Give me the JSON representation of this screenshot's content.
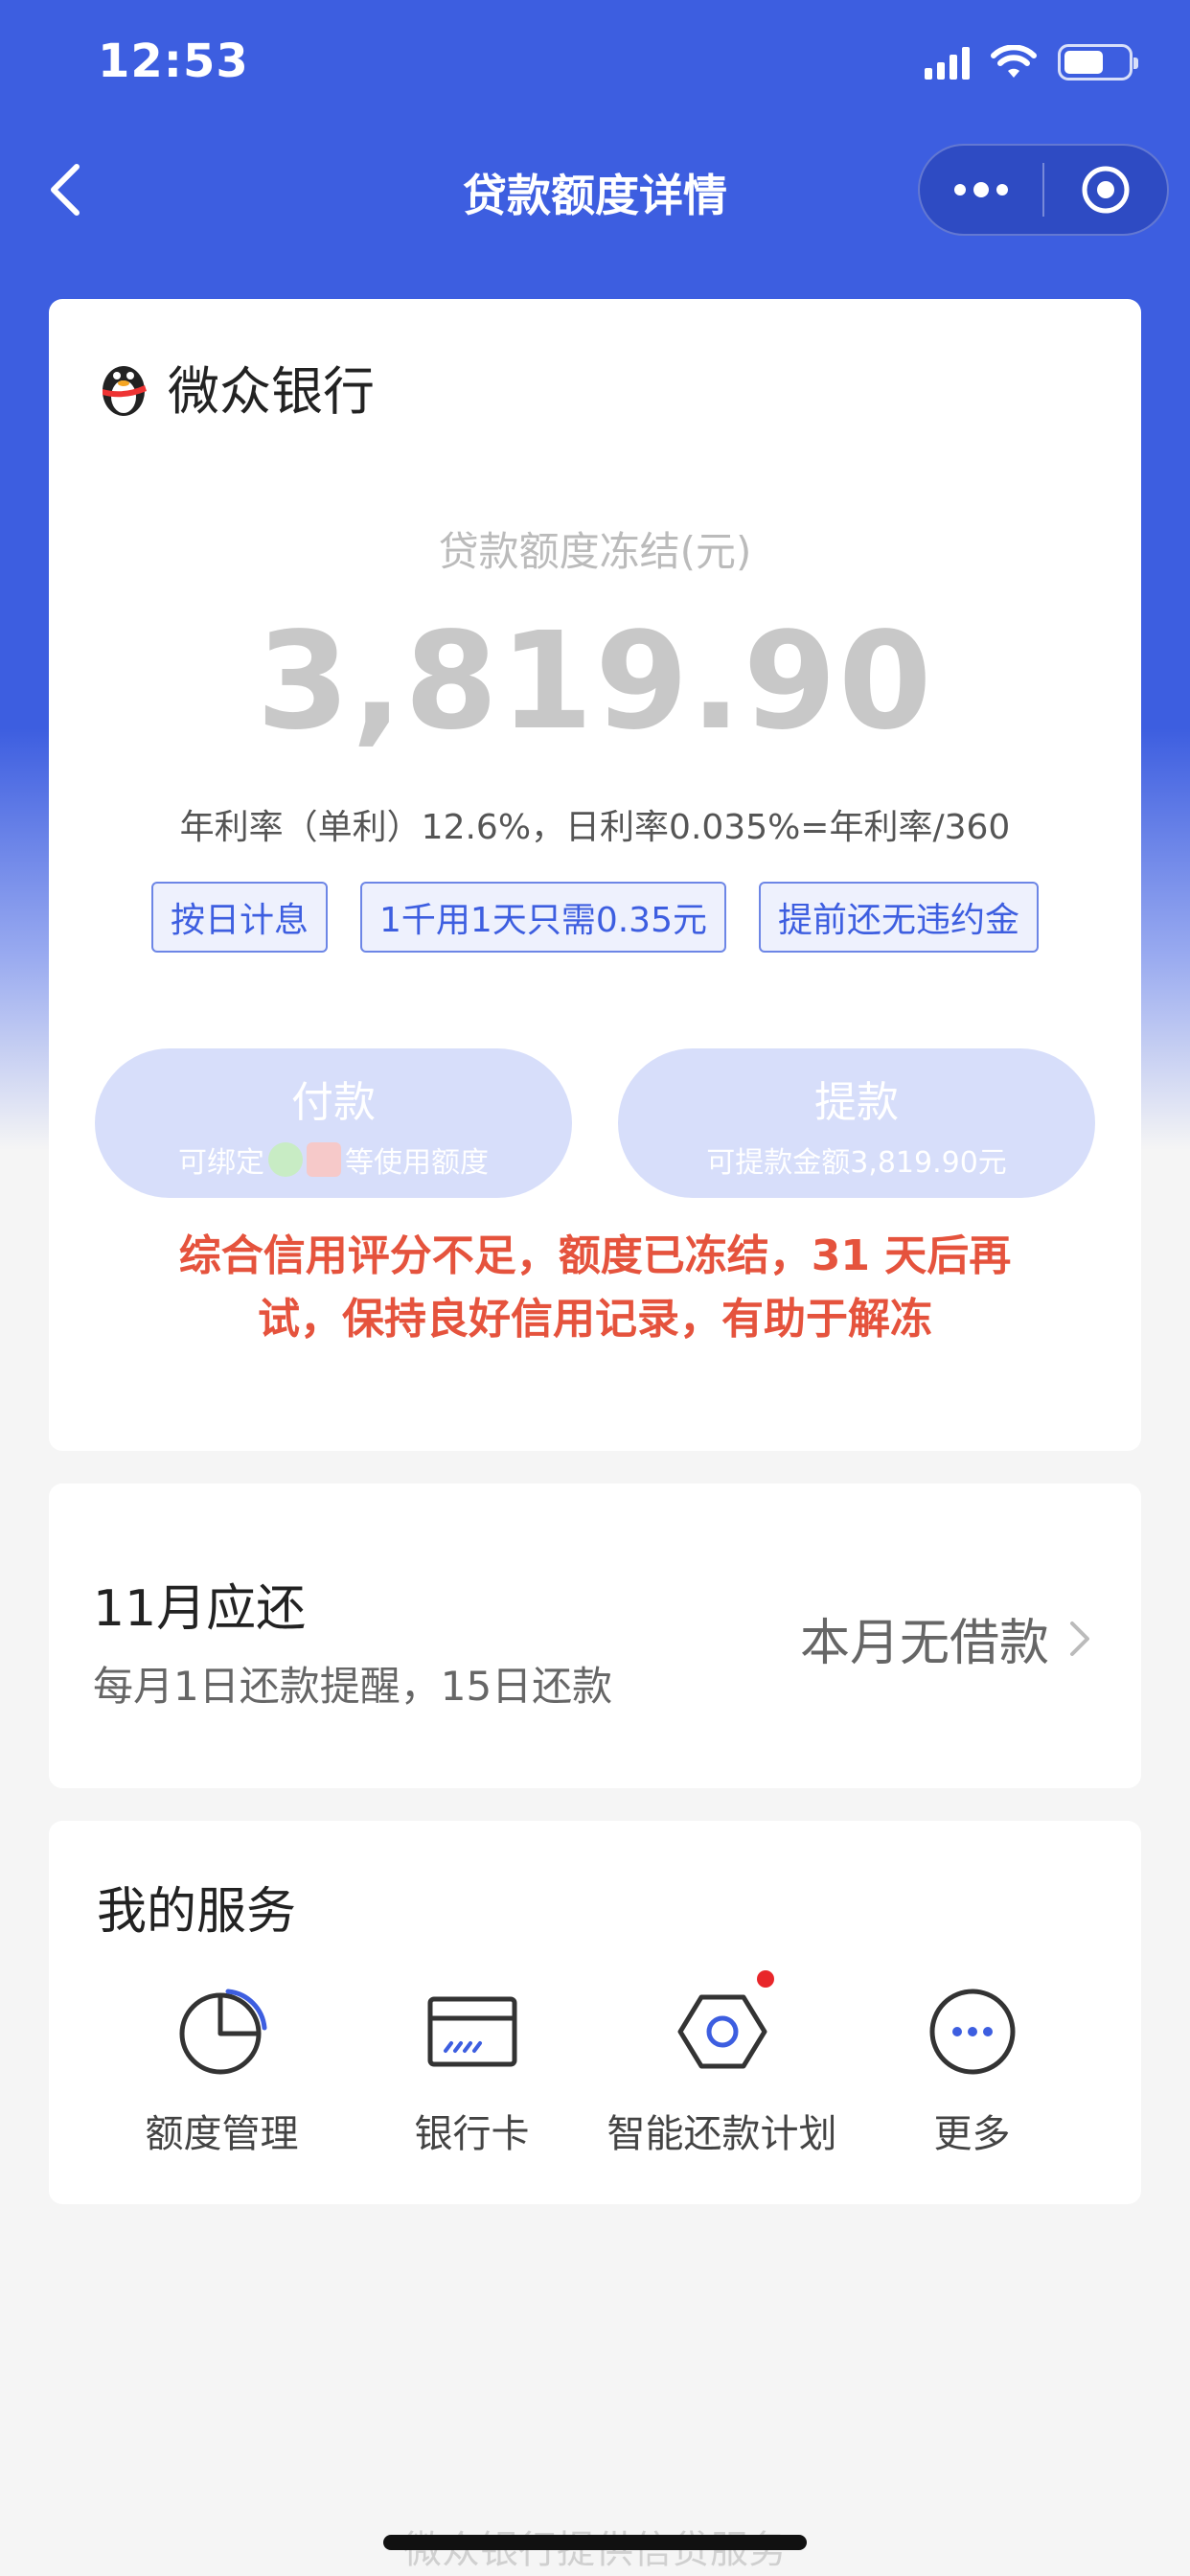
{
  "status_bar": {
    "time": "12:53"
  },
  "nav": {
    "title": "贷款额度详情"
  },
  "bank": {
    "name": "微众银行"
  },
  "loan": {
    "amount_label": "贷款额度冻结(元)",
    "amount": "3,819.90",
    "rate_text": "年利率（单利）12.6%，日利率0.035%=年利率/360",
    "tags": [
      "按日计息",
      "1千用1天只需0.35元",
      "提前还无违约金"
    ]
  },
  "actions": {
    "pay": {
      "title": "付款",
      "sub_before": "可绑定",
      "sub_after": "等使用额度"
    },
    "withdraw": {
      "title": "提款",
      "sub": "可提款金额3,819.90元"
    }
  },
  "warning": "综合信用评分不足，额度已冻结，31 天后再试，保持良好信用记录，有助于解冻",
  "repay": {
    "title": "11月应还",
    "subtitle": "每月1日还款提醒，15日还款",
    "status": "本月无借款"
  },
  "services": {
    "title": "我的服务",
    "items": [
      {
        "label": "额度管理",
        "icon": "pie-chart-icon"
      },
      {
        "label": "银行卡",
        "icon": "bank-card-icon"
      },
      {
        "label": "智能还款计划",
        "icon": "hexagon-plan-icon"
      },
      {
        "label": "更多",
        "icon": "more-icon"
      }
    ]
  },
  "footer": {
    "text": "微众银行提供信贷服务"
  },
  "colors": {
    "primary": "#3d5ee0",
    "warning": "#e5533d",
    "button_disabled": "#d7defa"
  }
}
